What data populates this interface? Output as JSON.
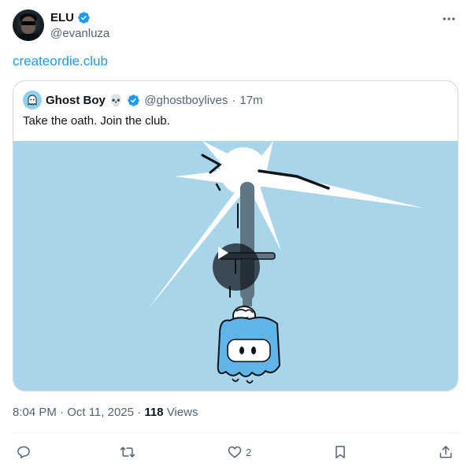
{
  "author": {
    "name": "ELU",
    "handle": "@evanluza",
    "verified": true
  },
  "post": {
    "link_text": "createordie.club"
  },
  "quoted": {
    "name": "Ghost Boy",
    "emoji": "💀",
    "handle": "@ghostboylives",
    "separator": "·",
    "time": "17m",
    "text": "Take the oath. Join the club."
  },
  "meta": {
    "timestamp": "8:04 PM · Oct 11, 2025",
    "separator": "·",
    "views_count": "118",
    "views_label": "Views"
  },
  "actions": {
    "reply_count": "",
    "repost_count": "",
    "like_count": "2",
    "bookmark_count": "",
    "share_count": ""
  },
  "icons": [
    "verified-badge-icon",
    "more-icon",
    "play-icon",
    "reply-icon",
    "repost-icon",
    "like-icon",
    "bookmark-icon",
    "share-icon"
  ],
  "colors": {
    "link": "#1d9bf0",
    "verified": "#1d9bf0",
    "secondary_text": "#536471",
    "media_background": "#a8d5ea"
  }
}
